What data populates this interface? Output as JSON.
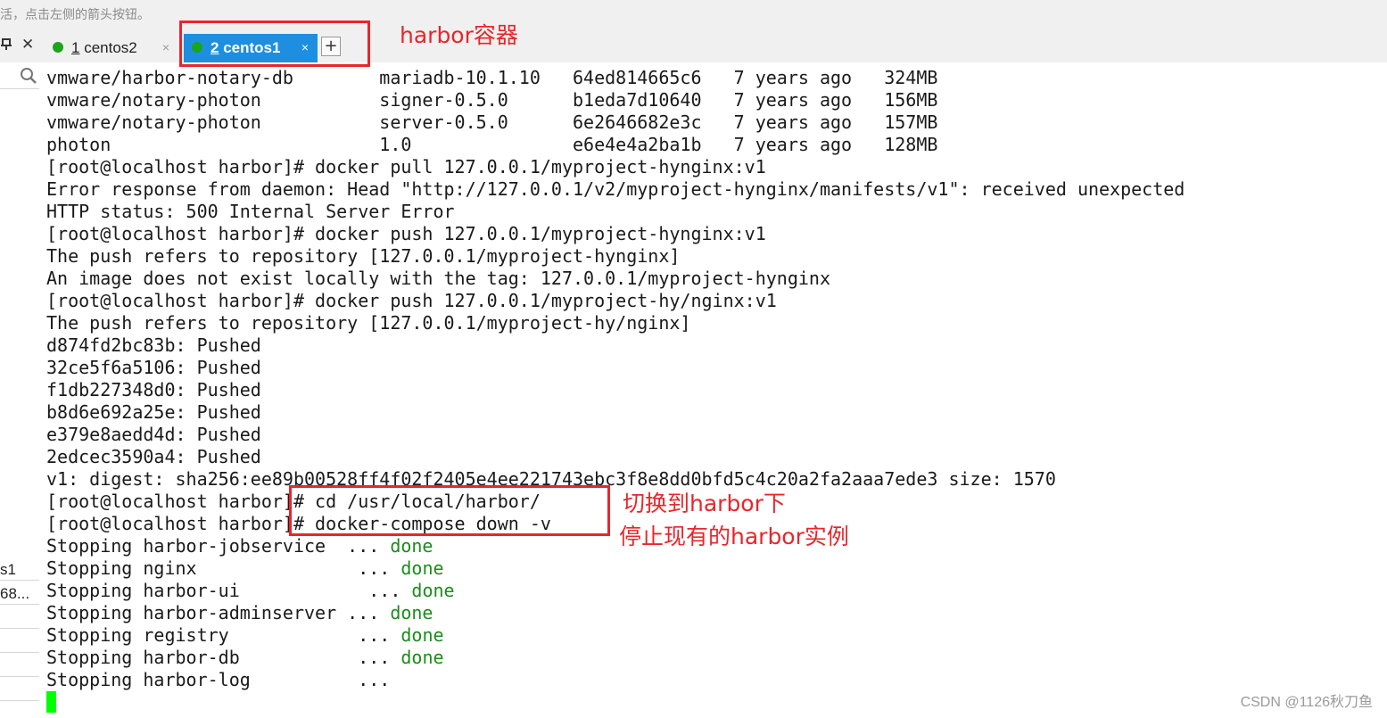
{
  "top_hint": "活，点击左侧的箭头按钮。",
  "panel": {
    "pin_icon": "pin-icon",
    "close_glyph": "✕"
  },
  "tabs": [
    {
      "number": "1",
      "label": "centos2",
      "close": "×",
      "status_color": "#1aa51a",
      "active": false
    },
    {
      "number": "2",
      "label": "centos1",
      "close": "×",
      "status_color": "#1aa51a",
      "active": true
    }
  ],
  "add_tab": "+",
  "sidebar": {
    "search_icon": "search-icon",
    "rows": [
      "s1",
      "68..."
    ]
  },
  "terminal": {
    "lines": [
      {
        "text": "vmware/harbor-notary-db        mariadb-10.1.10   64ed814665c6   7 years ago   324MB"
      },
      {
        "text": "vmware/notary-photon           signer-0.5.0      b1eda7d10640   7 years ago   156MB"
      },
      {
        "text": "vmware/notary-photon           server-0.5.0      6e2646682e3c   7 years ago   157MB"
      },
      {
        "text": "photon                         1.0               e6e4e4a2ba1b   7 years ago   128MB"
      },
      {
        "text": "[root@localhost harbor]# docker pull 127.0.0.1/myproject-hynginx:v1"
      },
      {
        "text": "Error response from daemon: Head \"http://127.0.0.1/v2/myproject-hynginx/manifests/v1\": received unexpected"
      },
      {
        "text": "HTTP status: 500 Internal Server Error"
      },
      {
        "text": "[root@localhost harbor]# docker push 127.0.0.1/myproject-hynginx:v1"
      },
      {
        "text": "The push refers to repository [127.0.0.1/myproject-hynginx]"
      },
      {
        "text": "An image does not exist locally with the tag: 127.0.0.1/myproject-hynginx"
      },
      {
        "text": "[root@localhost harbor]# docker push 127.0.0.1/myproject-hy/nginx:v1"
      },
      {
        "text": "The push refers to repository [127.0.0.1/myproject-hy/nginx]"
      },
      {
        "text": "d874fd2bc83b: Pushed"
      },
      {
        "text": "32ce5f6a5106: Pushed"
      },
      {
        "text": "f1db227348d0: Pushed"
      },
      {
        "text": "b8d6e692a25e: Pushed"
      },
      {
        "text": "e379e8aedd4d: Pushed"
      },
      {
        "text": "2edcec3590a4: Pushed"
      },
      {
        "text": "v1: digest: sha256:ee89b00528ff4f02f2405e4ee221743ebc3f8e8dd0bfd5c4c20a2fa2aaa7ede3 size: 1570"
      },
      {
        "text": "[root@localhost harbor]# cd /usr/local/harbor/"
      },
      {
        "text": "[root@localhost harbor]# docker-compose down -v"
      },
      {
        "text": "Stopping harbor-jobservice  ... ",
        "status": "done"
      },
      {
        "text": "Stopping nginx               ... ",
        "status": "done"
      },
      {
        "text": "Stopping harbor-ui            ... ",
        "status": "done"
      },
      {
        "text": "Stopping harbor-adminserver ... ",
        "status": "done"
      },
      {
        "text": "Stopping registry            ... ",
        "status": "done"
      },
      {
        "text": "Stopping harbor-db           ... ",
        "status": "done"
      },
      {
        "text": "Stopping harbor-log          ..."
      }
    ],
    "cursor_color": "#00ff00",
    "done_color": "#1b8c1b"
  },
  "annotations": {
    "tab_label": "harbor容器",
    "command_label_1": "切换到harbor下",
    "command_label_2": "停止现有的harbor实例",
    "color": "#e8262b"
  },
  "watermark": "CSDN @1126秋刀鱼"
}
